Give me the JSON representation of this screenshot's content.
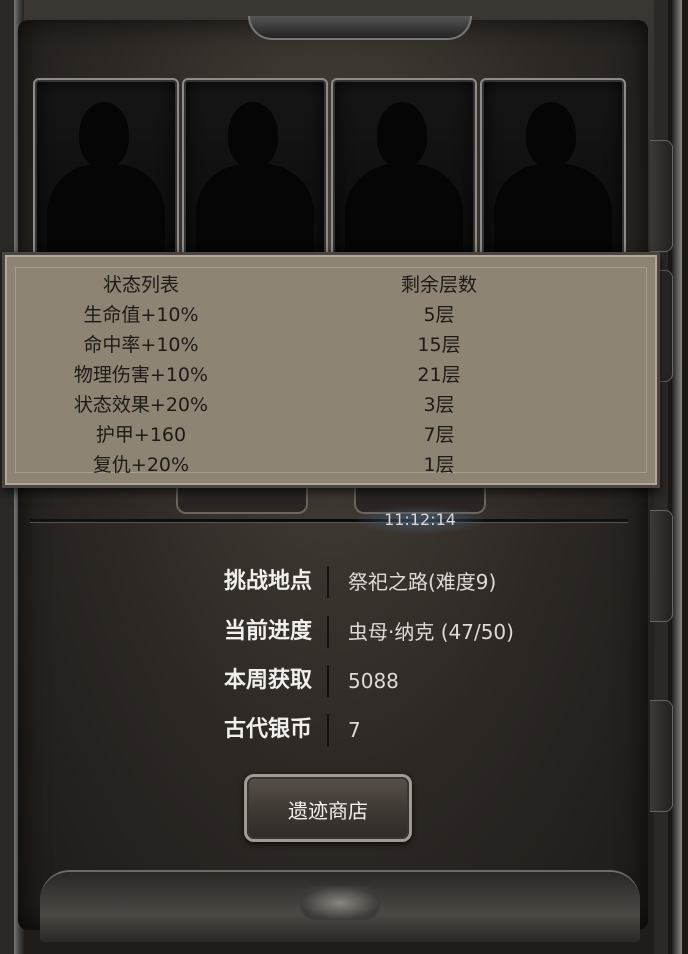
{
  "portraits": [
    {
      "state": "locked"
    },
    {
      "state": "locked"
    },
    {
      "state": "locked"
    },
    {
      "state": "locked"
    }
  ],
  "status_table": {
    "header": {
      "name": "状态列表",
      "layers": "剩余层数"
    },
    "rows": [
      {
        "name": "生命值+10%",
        "layers": "5层"
      },
      {
        "name": "命中率+10%",
        "layers": "15层"
      },
      {
        "name": "物理伤害+10%",
        "layers": "21层"
      },
      {
        "name": "状态效果+20%",
        "layers": "3层"
      },
      {
        "name": "护甲+160",
        "layers": "7层"
      },
      {
        "name": "复仇+20%",
        "layers": "1层"
      }
    ]
  },
  "timer": "11:12:14",
  "info": [
    {
      "label": "挑战地点",
      "value": "祭祀之路(难度9)"
    },
    {
      "label": "当前进度",
      "value": "虫母·纳克 (47/50)"
    },
    {
      "label": "本周获取",
      "value": "5088"
    },
    {
      "label": "古代银币",
      "value": "7"
    }
  ],
  "shop_button": "遗迹商店",
  "colors": {
    "panel_bg": "#8d8474",
    "panel_text": "#1e1b17",
    "label_text": "#f2efec",
    "value_text": "#dedad5"
  }
}
